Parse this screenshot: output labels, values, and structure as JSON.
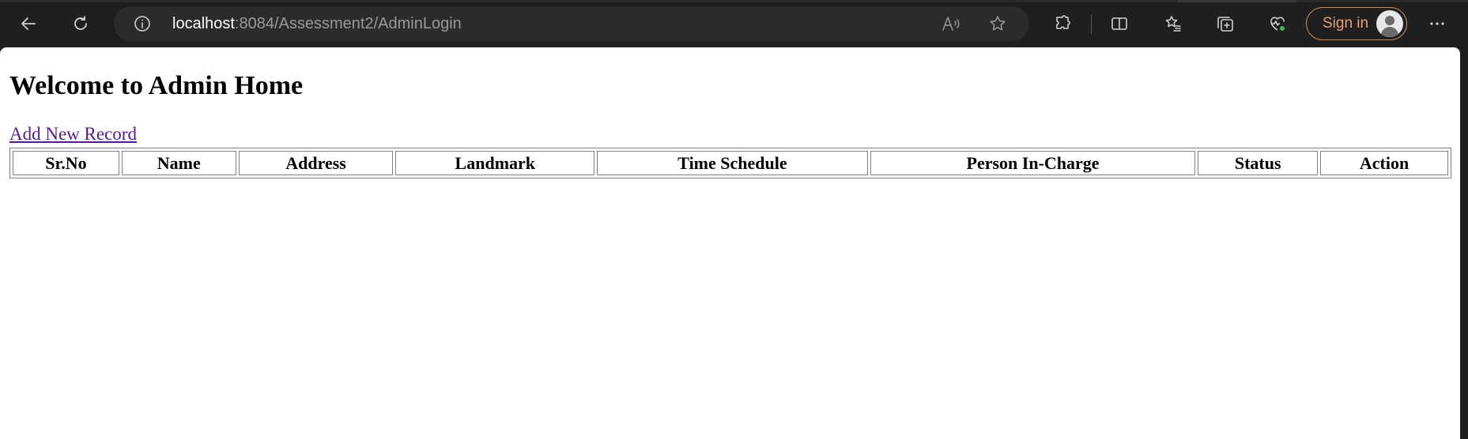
{
  "browser": {
    "url_host": "localhost",
    "url_rest": ":8084/Assessment2/AdminLogin",
    "signin_label": "Sign in",
    "icons": {
      "back": "back-arrow-icon",
      "refresh": "refresh-icon",
      "info": "info-icon",
      "read_aloud": "read-aloud-icon",
      "favorite": "star-icon",
      "extensions": "extensions-icon",
      "split_screen": "split-screen-icon",
      "favorites": "favorites-list-icon",
      "collections": "collections-icon",
      "health": "browser-essentials-icon",
      "more": "more-icon"
    }
  },
  "page": {
    "heading": "Welcome to Admin Home",
    "add_link": "Add New Record",
    "table": {
      "columns": [
        "Sr.No",
        "Name",
        "Address",
        "Landmark",
        "Time Schedule",
        "Person In-Charge",
        "Status",
        "Action"
      ],
      "rows": []
    }
  },
  "colors": {
    "toolbar_bg": "#1f1f1f",
    "address_bg": "#2b2b2b",
    "signin_accent": "#e9a070",
    "visited_link": "#551a8b"
  }
}
